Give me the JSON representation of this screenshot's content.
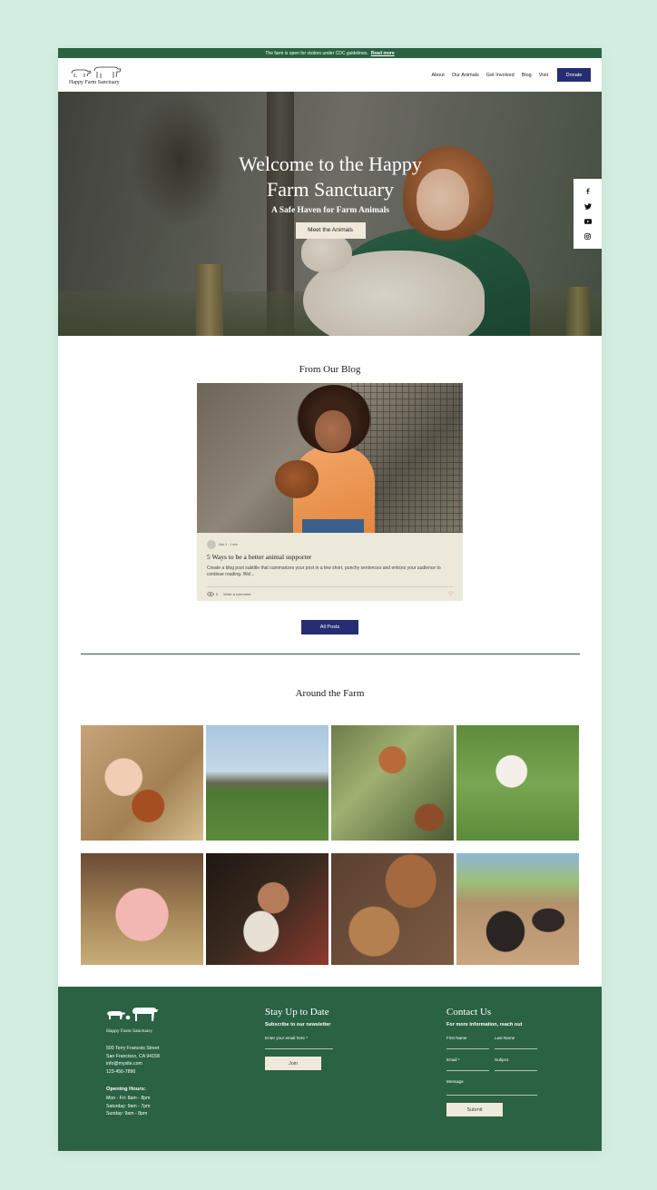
{
  "announcement": {
    "text": "The farm is open for visitors under CDC guidelines.",
    "link": "Read more"
  },
  "header": {
    "logo_text": "Happy Farm Sanctuary",
    "nav": [
      "About",
      "Our Animals",
      "Get Involved",
      "Blog",
      "Visit"
    ],
    "donate_label": "Donate"
  },
  "hero": {
    "title_line1": "Welcome to the Happy",
    "title_line2": "Farm Sanctuary",
    "subtitle": "A Safe Haven for Farm Animals",
    "button": "Meet the Animals",
    "social_icons": [
      "facebook-icon",
      "twitter-icon",
      "youtube-icon",
      "instagram-icon"
    ]
  },
  "blog": {
    "section_title": "From Our Blog",
    "post": {
      "author_meta": "Dec 1 · 1 min",
      "title": "5 Ways to be a better animal supporter",
      "excerpt": "Create a blog post subtitle that summarizes your post in a few short, punchy sentences and entices your audience to continue reading. Wel...",
      "views": "0",
      "comment_label": "Write a comment"
    },
    "all_posts_label": "All Posts"
  },
  "gallery": {
    "section_title": "Around the Farm",
    "tiles": [
      "girl-with-hen",
      "horse-in-field",
      "hens-on-fence",
      "leaping-lamb",
      "pig",
      "man-hugging-lamb",
      "cow-and-calf",
      "pigs-resting"
    ]
  },
  "footer": {
    "logo_text": "Happy Farm Sanctuary",
    "address": [
      "500 Terry Francois Street",
      "San Francisco, CA 94158",
      "info@mysite.com",
      "123-456-7890"
    ],
    "hours_title": "Opening Hours:",
    "hours": [
      "Mon - Fri: 8am - 8pm",
      "Saturday: 9am - 7pm",
      "Sunday: 9am - 8pm"
    ],
    "newsletter": {
      "title": "Stay Up to Date",
      "subtitle": "Subscribe to our newsletter",
      "email_label": "Enter your email here *",
      "button": "Join"
    },
    "contact": {
      "title": "Contact Us",
      "subtitle": "For more information, reach out",
      "first_name": "First Name",
      "last_name": "Last Name",
      "email": "Email *",
      "subject": "Subject",
      "message": "Message",
      "button": "Submit"
    }
  },
  "colors": {
    "brand_green": "#2a6243",
    "navy": "#262d73",
    "cream": "#efe9da",
    "background": "#d4efe2"
  }
}
